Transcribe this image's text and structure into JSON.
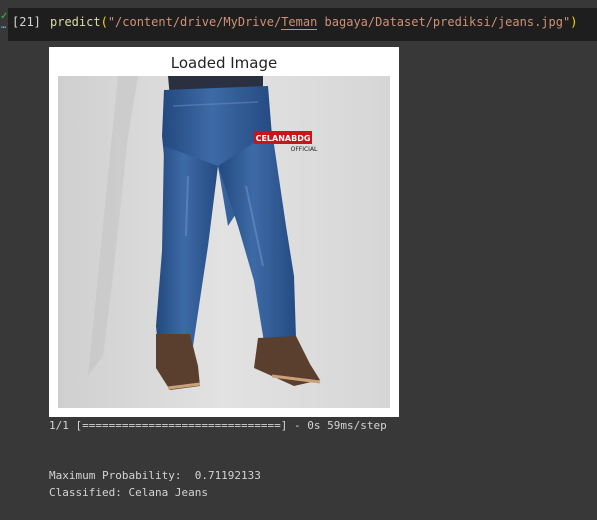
{
  "cell": {
    "execution_count": "[21]",
    "code": {
      "function": "predict",
      "open_paren": "(",
      "path_prefix": "\"/content/drive/MyDrive/",
      "path_underlined": "Teman",
      "path_suffix": " bagaya/Dataset/prediksi/jeans.jpg\"",
      "close_paren": ")"
    }
  },
  "output": {
    "figure": {
      "title": "Loaded Image",
      "image_subject": "model wearing blue jeans and brown shoes",
      "brand_logo": {
        "main": "CELANABDG",
        "sub": "OFFICIAL"
      }
    },
    "progress_line": "1/1 [==============================] - 0s 59ms/step",
    "max_prob_line": "Maximum Probability:  0.71192133",
    "classified_line": "Classified: Celana Jeans"
  },
  "colors": {
    "page_bg": "#383838",
    "cell_bg": "#1e1e1e",
    "string": "#ce9178",
    "function": "#dcdcaa",
    "bracket": "#ffd700",
    "denim": "#2f5a94",
    "shoe": "#5b3f2e"
  }
}
